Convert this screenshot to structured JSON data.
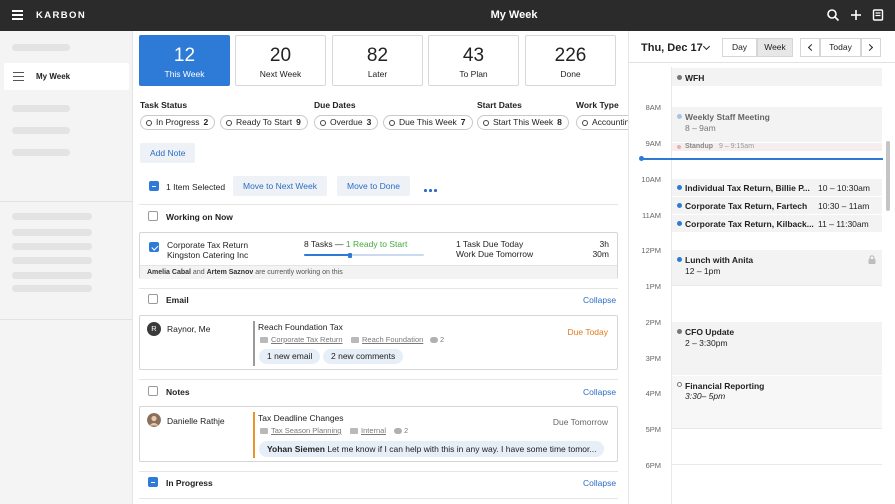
{
  "app": {
    "brand": "KARBON",
    "title": "My Week"
  },
  "sidebar": {
    "active_label": "My Week"
  },
  "cards": [
    {
      "num": "12",
      "label": "This Week"
    },
    {
      "num": "20",
      "label": "Next Week"
    },
    {
      "num": "82",
      "label": "Later"
    },
    {
      "num": "43",
      "label": "To Plan"
    },
    {
      "num": "226",
      "label": "Done"
    }
  ],
  "filters": {
    "task_status": {
      "title": "Task Status",
      "chips": [
        {
          "label": "In Progress",
          "count": "2"
        },
        {
          "label": "Ready To Start",
          "count": "9"
        }
      ]
    },
    "due_dates": {
      "title": "Due Dates",
      "chips": [
        {
          "label": "Overdue",
          "count": "3"
        },
        {
          "label": "Due This Week",
          "count": "7"
        }
      ]
    },
    "start_dates": {
      "title": "Start Dates",
      "chips": [
        {
          "label": "Start This Week",
          "count": "8"
        }
      ]
    },
    "work_type": {
      "title": "Work Type",
      "chips": [
        {
          "label": "Accounting",
          "count": ""
        }
      ]
    }
  },
  "toolbar": {
    "add_note": "Add Note",
    "selected": "1 Item Selected",
    "move_next": "Move to Next Week",
    "move_done": "Move to Done"
  },
  "sections": {
    "working_on_now": {
      "title": "Working on Now",
      "item": {
        "title": "Corporate Tax Return",
        "client": "Kingston Catering Inc",
        "tasks": "8 Tasks —",
        "ready": "1 Ready to Start",
        "due_today": "1 Task Due Today",
        "due_tomorrow": "Work Due Tomorrow",
        "time1": "3h",
        "time2": "30m",
        "footer_user1": "Amelia Cabal",
        "footer_and": "and",
        "footer_user2": "Artem Saznov",
        "footer_rest": "are currently working on this",
        "progress": 0.38
      }
    },
    "email": {
      "title": "Email",
      "collapse": "Collapse",
      "item": {
        "from": "Raynor, Me",
        "avatar": "R",
        "subject": "Reach Foundation Tax",
        "work": "Corporate Tax Return",
        "client": "Reach Foundation",
        "comments": "2",
        "due": "Due Today",
        "pill1": "1 new email",
        "pill2": "2 new comments"
      }
    },
    "notes": {
      "title": "Notes",
      "collapse": "Collapse",
      "item": {
        "from": "Danielle Rathje",
        "subject": "Tax Deadline Changes",
        "work": "Tax Season Planning",
        "client": "Internal",
        "comments": "2",
        "due": "Due Tomorrow",
        "quote_name": "Yohan Siemen",
        "quote_text": "Let me know if I can help with this in any way. I have some time tomor..."
      }
    },
    "in_progress": {
      "title": "In Progress",
      "collapse": "Collapse"
    }
  },
  "calendar": {
    "date": "Thu, Dec 17",
    "view_day": "Day",
    "view_week": "Week",
    "today": "Today",
    "hours": [
      "8AM",
      "9AM",
      "10AM",
      "11AM",
      "12PM",
      "1PM",
      "2PM",
      "3PM",
      "4PM",
      "5PM",
      "6PM"
    ],
    "events": {
      "wfh": "WFH",
      "staff_title": "Weekly Staff Meeting",
      "staff_time": "8 – 9am",
      "standup_title": "Standup",
      "standup_time": "9 – 9:15am",
      "e1_title": "Individual Tax Return, Billie P...",
      "e1_time": "10 – 10:30am",
      "e2_title": "Corporate Tax Return, Fartech",
      "e2_time": "10:30 – 11am",
      "e3_title": "Corporate Tax Return, Kilback...",
      "e3_time": "11 – 11:30am",
      "lunch_title": "Lunch with Anita",
      "lunch_time": "12 – 1pm",
      "cfo_title": "CFO Update",
      "cfo_time": "2 – 3:30pm",
      "fin_title": "Financial Reporting",
      "fin_time": "3:30– 5pm"
    }
  },
  "colors": {
    "accent": "#2d7bd6",
    "link": "#2d6dc6",
    "due_today": "#e07b1f",
    "ready": "#43a93f",
    "note_bar": "#e8942b"
  }
}
